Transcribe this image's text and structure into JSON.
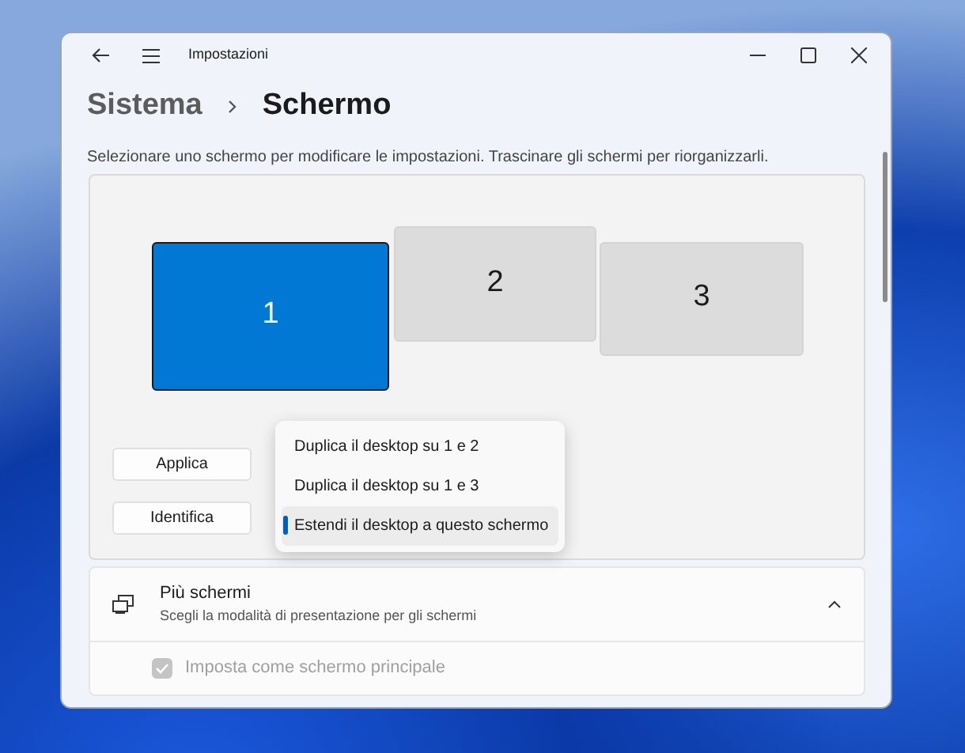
{
  "window": {
    "title": "Impostazioni"
  },
  "breadcrumb": {
    "parent": "Sistema",
    "current": "Schermo"
  },
  "description": "Selezionare uno schermo per modificare le impostazioni. Trascinare gli schermi per riorganizzarli.",
  "monitors": [
    {
      "label": "1",
      "selected": true
    },
    {
      "label": "2",
      "selected": false
    },
    {
      "label": "3",
      "selected": false
    }
  ],
  "buttons": [
    "Applica",
    "Identifica"
  ],
  "dropdown": {
    "options": [
      {
        "label": "Duplica il desktop su 1 e 2",
        "selected": false
      },
      {
        "label": "Duplica il desktop su 1 e 3",
        "selected": false
      },
      {
        "label": "Estendi il desktop a questo schermo",
        "selected": true
      }
    ]
  },
  "section": {
    "title": "Più schermi",
    "subtitle": "Scegli la modalità di presentazione per gli schermi",
    "expanded": true
  },
  "options": [
    {
      "label": "Imposta come schermo principale",
      "checked": true,
      "disabled": true
    }
  ]
}
